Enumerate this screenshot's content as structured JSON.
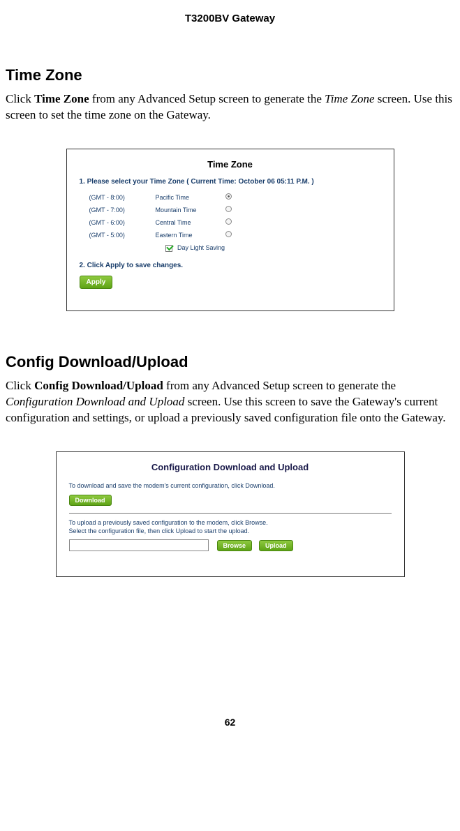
{
  "header": {
    "title": "T3200BV Gateway"
  },
  "section1": {
    "heading": "Time Zone",
    "para_pre": "Click ",
    "para_bold": "Time Zone",
    "para_mid": " from any Advanced Setup screen to generate the ",
    "para_italic": "Time Zone",
    "para_post": " screen. Use this screen to set the time zone on the Gateway."
  },
  "tz": {
    "title": "Time Zone",
    "step1": "1. Please select your Time Zone   ( Current Time:  October 06 05:11 P.M. )",
    "rows": [
      {
        "gmt": "(GMT - 8:00)",
        "name": "Pacific Time",
        "checked": true
      },
      {
        "gmt": "(GMT - 7:00)",
        "name": "Mountain Time",
        "checked": false
      },
      {
        "gmt": "(GMT - 6:00)",
        "name": "Central Time",
        "checked": false
      },
      {
        "gmt": "(GMT - 5:00)",
        "name": "Eastern Time",
        "checked": false
      }
    ],
    "daylight": "Day Light Saving",
    "step2": "2. Click Apply to save changes.",
    "apply": "Apply"
  },
  "section2": {
    "heading": "Config Download/Upload",
    "para_pre": "Click ",
    "para_bold": "Config Download/Upload",
    "para_mid": " from any Advanced Setup screen to generate the ",
    "para_italic": "Configuration Download and Upload",
    "para_post": " screen. Use this screen to save the Gateway's current configuration and settings, or upload a previously saved configuration file onto the Gateway."
  },
  "cfg": {
    "title": "Configuration Download and Upload",
    "text1": "To download and save the modem's current configuration, click Download.",
    "download": "Download",
    "text2a": "To upload a previously saved configuration to the modem, click Browse.",
    "text2b": "Select the configuration file, then click Upload to start the upload.",
    "browse": "Browse",
    "upload": "Upload"
  },
  "footer": {
    "page": "62"
  }
}
